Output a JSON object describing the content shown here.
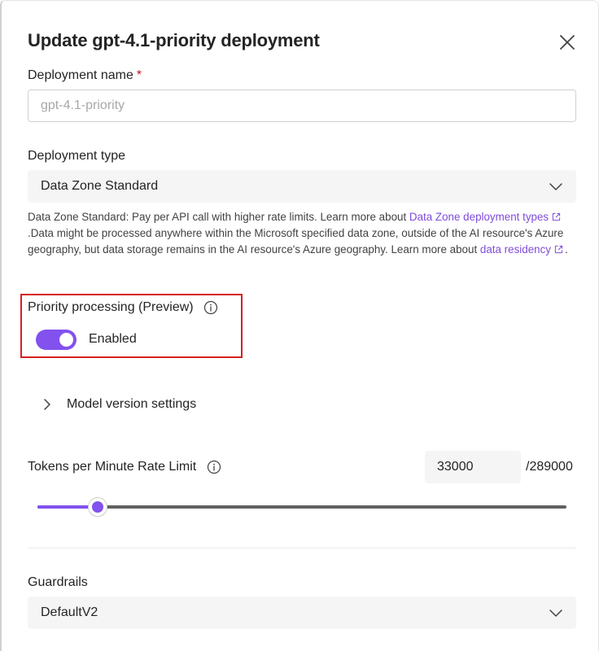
{
  "dialog": {
    "title": "Update gpt-4.1-priority deployment",
    "close_icon": "close-icon"
  },
  "deployment_name": {
    "label": "Deployment name",
    "required_mark": "*",
    "placeholder": "gpt-4.1-priority",
    "value": ""
  },
  "deployment_type": {
    "label": "Deployment type",
    "selected": "Data Zone Standard",
    "icon": "chevron-down-icon",
    "description_prefix": "Data Zone Standard: Pay per API call with higher rate limits. Learn more about ",
    "link_types": "Data Zone deployment types",
    "description_middle": ".Data might be processed anywhere within the Microsoft specified data zone, outside of the AI resource's Azure geography, but data storage remains in the AI resource's Azure geography. Learn more about ",
    "link_residency": "data residency",
    "description_suffix": "."
  },
  "priority_processing": {
    "label": "Priority processing (Preview)",
    "info_icon": "info-icon",
    "toggle_state": "on",
    "toggle_label": "Enabled",
    "highlight_color": "#d72020"
  },
  "model_version": {
    "label": "Model version settings",
    "icon": "chevron-right-icon",
    "expanded": false
  },
  "tpm": {
    "label": "Tokens per Minute Rate Limit",
    "info_icon": "info-icon",
    "value": "33000",
    "max_text": "/289000",
    "slider_fraction": 0.114
  },
  "guardrails": {
    "label": "Guardrails",
    "selected": "DefaultV2",
    "icon": "chevron-down-icon"
  },
  "colors": {
    "accent": "#8251ee",
    "link": "#7f4cdb",
    "required": "#c50f1f"
  }
}
